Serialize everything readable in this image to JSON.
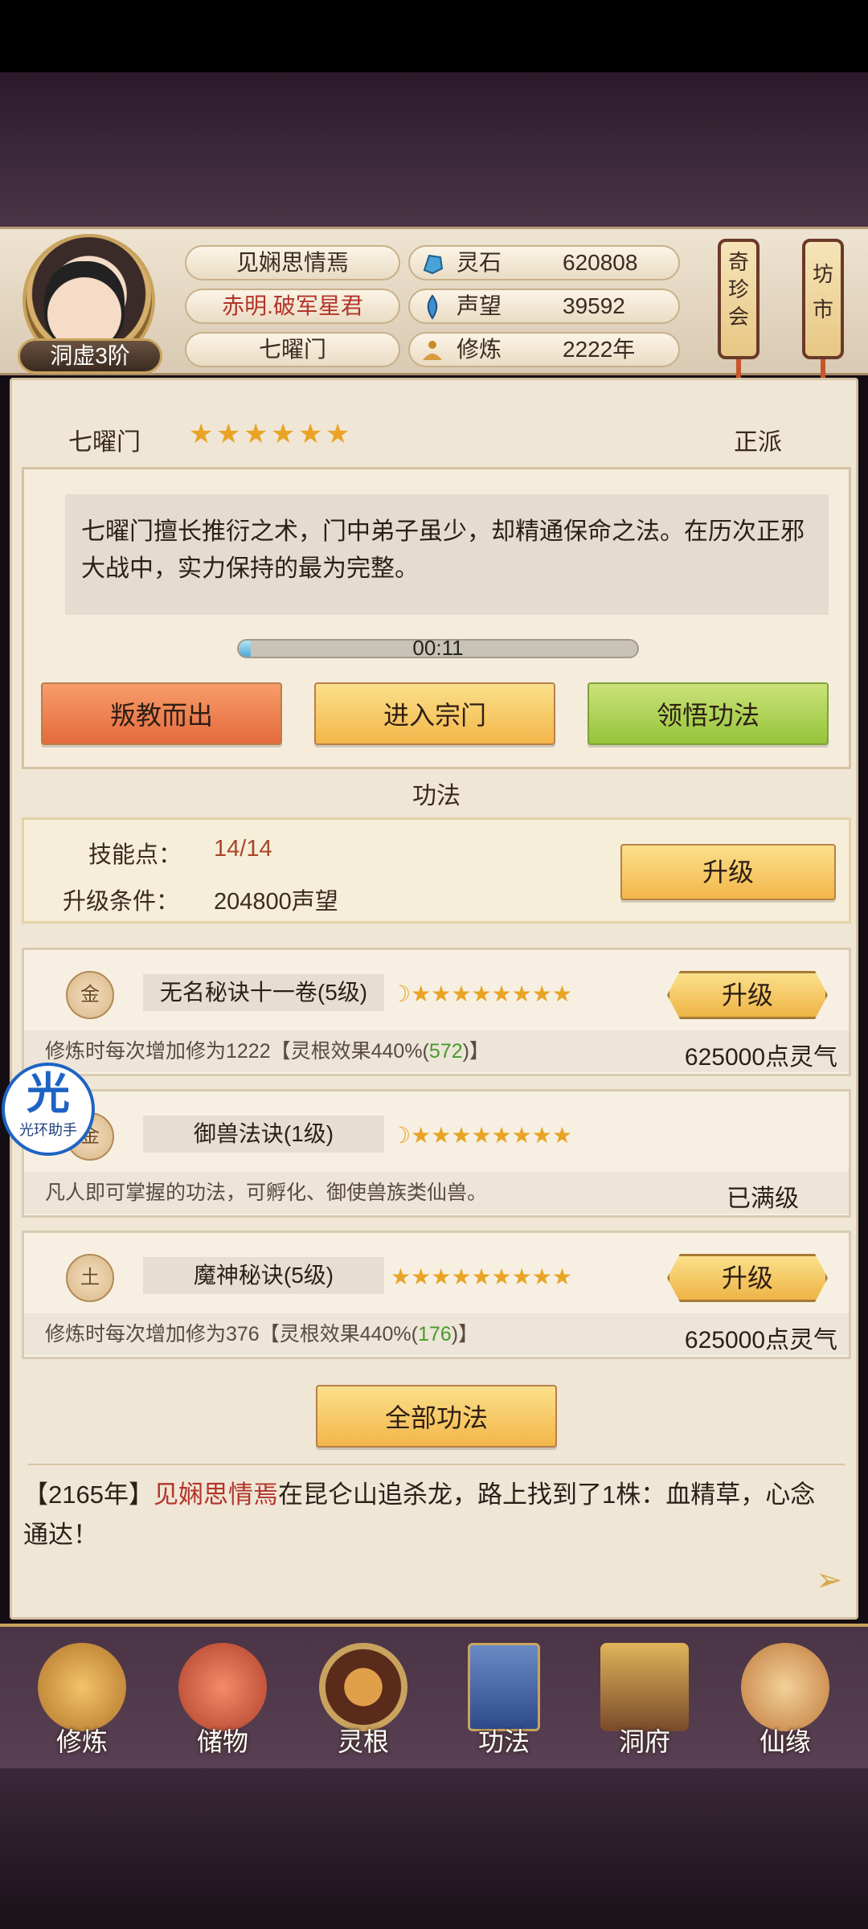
{
  "player": {
    "name": "见娴思情焉",
    "title": "赤明.破军星君",
    "sect": "七曜门",
    "rank": "洞虚3阶"
  },
  "resources": [
    {
      "label": "灵石",
      "value": "620808",
      "icon": "spirit-stone-icon"
    },
    {
      "label": "声望",
      "value": "39592",
      "icon": "reputation-icon"
    },
    {
      "label": "修炼",
      "value": "2222年",
      "icon": "cultivation-icon"
    }
  ],
  "lanterns": {
    "treasure": "奇珍会",
    "market": "坊市"
  },
  "sect_info": {
    "name": "七曜门",
    "stars": 6,
    "alignment": "正派",
    "description": "七曜门擅长推衍之术，门中弟子虽少，却精通保命之法。在历次正邪大战中，实力保持的最为完整。",
    "timer": "00:11",
    "timer_progress": 0.03
  },
  "actions": {
    "leave": "叛教而出",
    "enter": "进入宗门",
    "learn": "领悟功法"
  },
  "gongfa": {
    "section_title": "功法",
    "skill_points_label": "技能点：",
    "skill_points_value": "14/14",
    "upgrade_cond_label": "升级条件：",
    "upgrade_cond_value": "204800声望",
    "upgrade_label": "升级",
    "all_label": "全部功法"
  },
  "techniques": [
    {
      "element": "金",
      "name": "无名秘诀十一卷(5级)",
      "moon": true,
      "stars": 8,
      "effect_prefix": "修炼时每次增加修为1222【灵根效果440%(",
      "effect_highlight": "572",
      "effect_suffix": ")】",
      "cost": "625000点灵气",
      "button": "升级"
    },
    {
      "element": "金",
      "name": "御兽法诀(1级)",
      "moon": true,
      "stars": 8,
      "effect_prefix": "凡人即可掌握的功法，可孵化、御使兽族类仙兽。",
      "effect_highlight": "",
      "effect_suffix": "",
      "cost": "已满级",
      "button": ""
    },
    {
      "element": "土",
      "name": "魔神秘诀(5级)",
      "moon": false,
      "stars": 9,
      "effect_prefix": "修炼时每次增加修为376【灵根效果440%(",
      "effect_highlight": "176",
      "effect_suffix": ")】",
      "cost": "625000点灵气",
      "button": "升级"
    }
  ],
  "log": {
    "year": "【2165年】",
    "name": "见娴思情焉",
    "text": "在昆仑山追杀龙，路上找到了1株：血精草，心念通达！"
  },
  "nav": [
    {
      "label": "修炼",
      "icon": "cultivate-monk-icon"
    },
    {
      "label": "储物",
      "icon": "storage-bag-icon"
    },
    {
      "label": "灵根",
      "icon": "spirit-root-icon"
    },
    {
      "label": "功法",
      "icon": "technique-book-icon"
    },
    {
      "label": "洞府",
      "icon": "cave-house-icon"
    },
    {
      "label": "仙缘",
      "icon": "immortal-fate-icon"
    }
  ],
  "helper": {
    "badge": "光",
    "label": "光环助手"
  },
  "colors": {
    "accent_red": "#b3342a",
    "highlight_green": "#4a9a2a",
    "gold": "#f3b64a"
  }
}
